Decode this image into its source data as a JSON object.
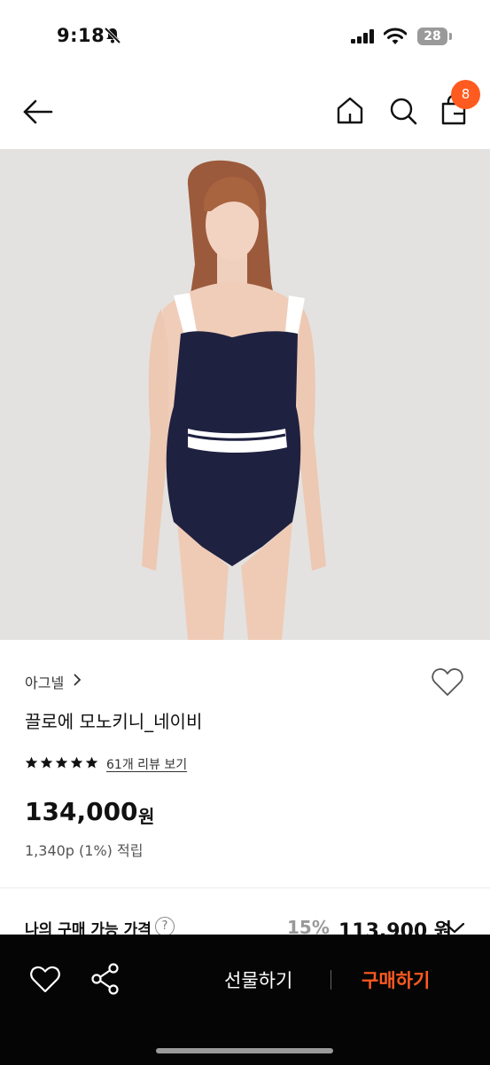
{
  "status_bar": {
    "time": "9:18",
    "battery": "28"
  },
  "nav": {
    "cart_badge": "8",
    "icons": [
      "back-arrow-icon",
      "home-icon",
      "search-icon",
      "cart-icon"
    ]
  },
  "product": {
    "brand": "아그넬",
    "name": "끌로에 모노키니_네이비",
    "rating_stars": 5,
    "review_link": "61개 리뷰 보기",
    "price": "134,000",
    "currency": "원",
    "points": "1,340p (1%) 적립"
  },
  "my_price": {
    "label": "나의 구매 가능 가격",
    "help": "?",
    "discount": "15%",
    "price": "113,900 원"
  },
  "bottom_bar": {
    "gift_label": "선물하기",
    "buy_label": "구매하기"
  },
  "colors": {
    "accent": "#ff5a1f",
    "bottom_bar_bg": "#050505",
    "hero_bg": "#e3e2e0",
    "swimsuit": "#1f2140"
  }
}
